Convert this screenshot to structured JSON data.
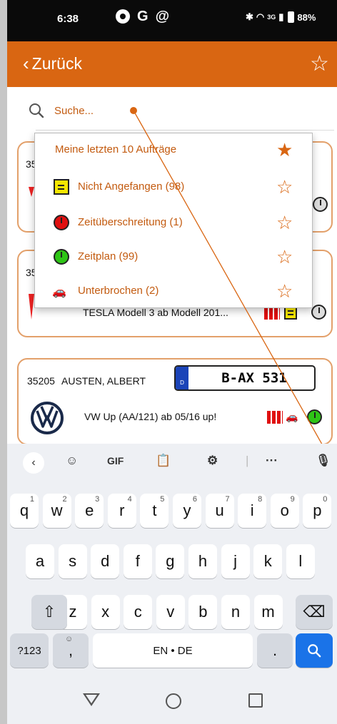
{
  "status_bar": {
    "time": "6:38",
    "left_icons": [
      "G"
    ],
    "network": "3G",
    "battery": "88%"
  },
  "app_bar": {
    "back_label": "Zurück",
    "back_chevron": "‹",
    "favorite_icon": "star-outline-icon"
  },
  "search": {
    "placeholder": "Suche..."
  },
  "dropdown": {
    "items": [
      {
        "label": "Meine letzten 10 Aufträge",
        "icon": "none",
        "starred": true,
        "star": "★"
      },
      {
        "label": "Nicht Angefangen (98)",
        "icon": "yellow-note-icon",
        "starred": false,
        "star": "☆"
      },
      {
        "label": "Zeitüberschreitung (1)",
        "icon": "red-clock-icon",
        "starred": false,
        "star": "☆"
      },
      {
        "label": "Zeitplan (99)",
        "icon": "green-clock-icon",
        "starred": false,
        "star": "☆"
      },
      {
        "label": "Unterbrochen (2)",
        "icon": "car-icon",
        "starred": false,
        "star": "☆"
      }
    ]
  },
  "orders": [
    {
      "number_clipped": "35"
    },
    {
      "number_clipped": "35",
      "vehicle": "TESLA Modell 3 ab Modell 201..."
    },
    {
      "number": "35205",
      "customer": "AUSTEN, ALBERT",
      "plate_country": "D",
      "plate": "B-AX 531",
      "vehicle": "VW Up (AA/121) ab 05/16 up!"
    }
  ],
  "keyboard": {
    "toolbar": {
      "back": "‹",
      "gif": "GIF",
      "more": "···"
    },
    "row1": [
      {
        "k": "q",
        "h": "1"
      },
      {
        "k": "w",
        "h": "2"
      },
      {
        "k": "e",
        "h": "3"
      },
      {
        "k": "r",
        "h": "4"
      },
      {
        "k": "t",
        "h": "5"
      },
      {
        "k": "y",
        "h": "6"
      },
      {
        "k": "u",
        "h": "7"
      },
      {
        "k": "i",
        "h": "8"
      },
      {
        "k": "o",
        "h": "9"
      },
      {
        "k": "p",
        "h": "0"
      }
    ],
    "row2": [
      "a",
      "s",
      "d",
      "f",
      "g",
      "h",
      "j",
      "k",
      "l"
    ],
    "row3": [
      "z",
      "x",
      "c",
      "v",
      "b",
      "n",
      "m"
    ],
    "symbols": "?123",
    "emoji_comma": ",",
    "space": "EN • DE",
    "period": ".",
    "shift": "⇧",
    "backspace": "⌫"
  },
  "colors": {
    "brand": "#d96612",
    "card_border": "#e3a06a",
    "link": "#c35b10",
    "enter_key": "#1a73e8"
  }
}
